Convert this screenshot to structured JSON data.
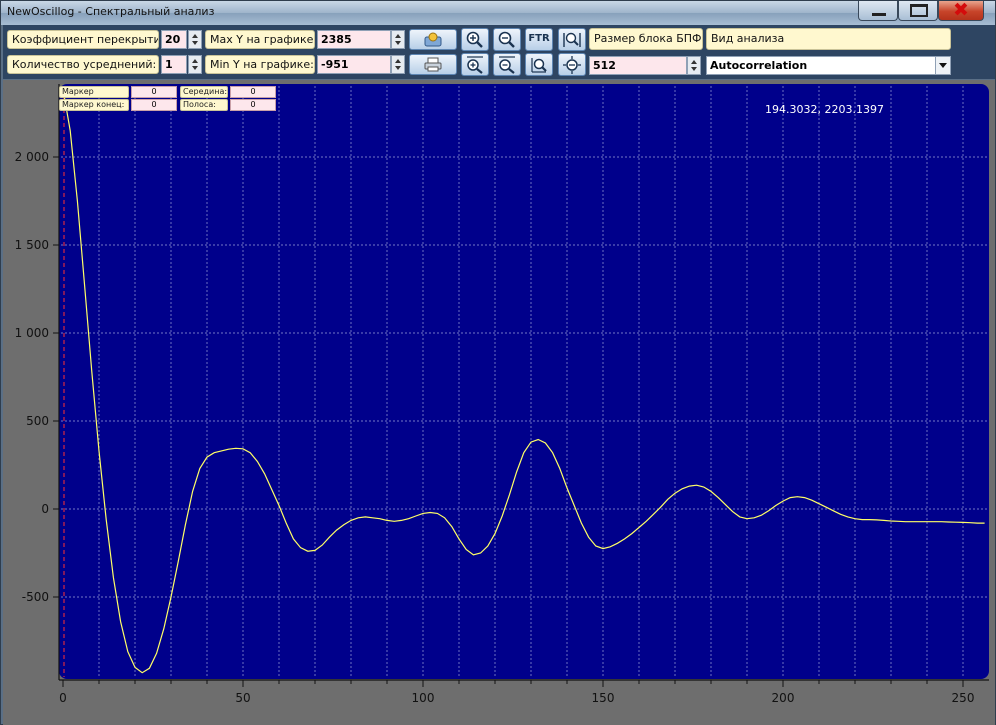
{
  "window": {
    "title": "NewOscillog - Спектральный анализ"
  },
  "toolbar": {
    "overlap_label": "Коэффициент перекрытия:",
    "overlap_value": "20",
    "averaging_label": "Количество усреднений:",
    "averaging_value": "1",
    "max_y_label": "Max Y на графике:",
    "max_y_value": "2385",
    "min_y_label": "Min Y на графике:",
    "min_y_value": "-951",
    "ftr_label": "FTR",
    "fft_block_label": "Размер блока БПФ",
    "fft_block_value": "512",
    "analysis_type_label": "Вид анализа",
    "analysis_type_value": "Autocorrelation"
  },
  "markers": {
    "start_label": "Маркер начало:",
    "start_value": "0",
    "end_label": "Маркер конец:",
    "end_value": "0",
    "middle_label": "Середина:",
    "middle_value": "0",
    "band_label": "Полоса:",
    "band_value": "0"
  },
  "cursor_readout": "194.3032, 2203.1397",
  "chart_data": {
    "type": "line",
    "title": "",
    "xlabel": "",
    "ylabel": "",
    "xlim": [
      0,
      256
    ],
    "ylim": [
      -951,
      2385
    ],
    "grid": true,
    "x_ticks": [
      0,
      50,
      100,
      150,
      200,
      250
    ],
    "x_tick_labels": [
      "0",
      "50",
      "100",
      "150",
      "200",
      "250"
    ],
    "y_ticks": [
      2000,
      1500,
      1000,
      500,
      0,
      -500
    ],
    "y_tick_labels": [
      "2 000",
      "1 500",
      "1 000",
      "500",
      "0",
      "-500"
    ],
    "series": [
      {
        "color": "#ffff66",
        "x": [
          0,
          2,
          4,
          6,
          8,
          10,
          12,
          14,
          16,
          18,
          20,
          22,
          24,
          26,
          28,
          30,
          32,
          34,
          36,
          38,
          40,
          42,
          44,
          46,
          48,
          50,
          52,
          54,
          56,
          58,
          60,
          62,
          64,
          66,
          68,
          70,
          72,
          74,
          76,
          78,
          80,
          82,
          84,
          86,
          88,
          90,
          92,
          94,
          96,
          98,
          100,
          102,
          104,
          106,
          108,
          110,
          112,
          114,
          116,
          118,
          120,
          122,
          124,
          126,
          128,
          130,
          132,
          134,
          136,
          138,
          140,
          142,
          144,
          146,
          148,
          150,
          152,
          154,
          156,
          158,
          160,
          162,
          164,
          166,
          168,
          170,
          172,
          174,
          176,
          178,
          180,
          182,
          184,
          186,
          188,
          190,
          192,
          194,
          196,
          198,
          200,
          202,
          204,
          206,
          208,
          210,
          212,
          214,
          216,
          218,
          220,
          222,
          224,
          226,
          228,
          230,
          232,
          234,
          236,
          238,
          240,
          242,
          244,
          246,
          248,
          250,
          252,
          254,
          256
        ],
        "values": [
          2385,
          2150,
          1750,
          1270,
          780,
          330,
          -60,
          -390,
          -640,
          -810,
          -900,
          -930,
          -905,
          -820,
          -680,
          -500,
          -300,
          -90,
          100,
          230,
          295,
          320,
          330,
          340,
          345,
          342,
          320,
          270,
          200,
          110,
          20,
          -80,
          -170,
          -220,
          -240,
          -235,
          -205,
          -160,
          -120,
          -90,
          -65,
          -50,
          -45,
          -50,
          -55,
          -65,
          -70,
          -65,
          -55,
          -40,
          -25,
          -20,
          -25,
          -50,
          -100,
          -170,
          -230,
          -260,
          -250,
          -210,
          -140,
          -40,
          80,
          210,
          320,
          380,
          395,
          375,
          320,
          230,
          120,
          20,
          -80,
          -160,
          -210,
          -225,
          -215,
          -195,
          -170,
          -140,
          -105,
          -70,
          -30,
          10,
          55,
          90,
          115,
          130,
          135,
          125,
          100,
          65,
          25,
          -15,
          -45,
          -55,
          -50,
          -35,
          -10,
          20,
          45,
          65,
          70,
          65,
          50,
          30,
          10,
          -10,
          -30,
          -45,
          -55,
          -60,
          -60,
          -62,
          -65,
          -68,
          -70,
          -72,
          -72,
          -72,
          -72,
          -72,
          -72,
          -74,
          -75,
          -76,
          -78,
          -80,
          -80
        ]
      }
    ]
  }
}
